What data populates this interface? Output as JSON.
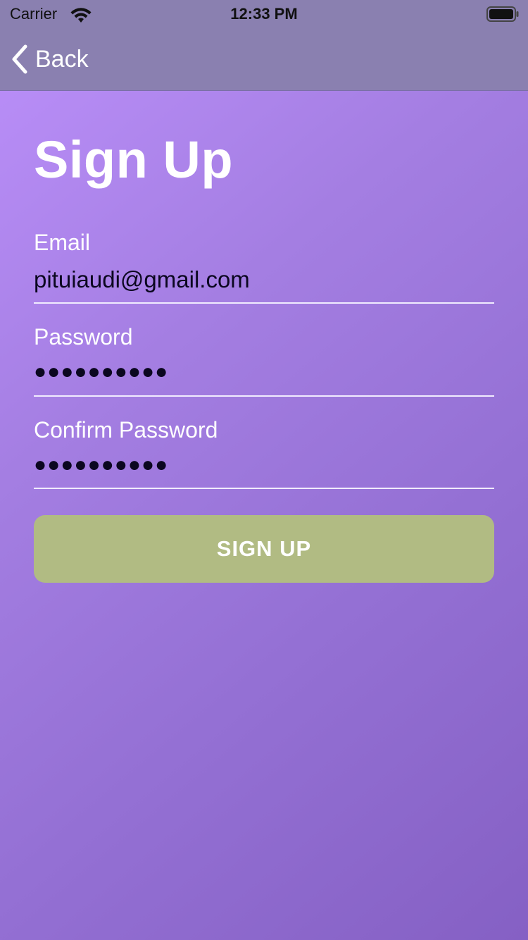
{
  "status_bar": {
    "carrier": "Carrier",
    "time": "12:33 PM"
  },
  "nav": {
    "back_label": "Back"
  },
  "page": {
    "title": "Sign Up"
  },
  "form": {
    "email": {
      "label": "Email",
      "value": "pituiaudi@gmail.com"
    },
    "password": {
      "label": "Password",
      "masked_value": "●●●●●●●●●●"
    },
    "confirm_password": {
      "label": "Confirm Password",
      "masked_value": "●●●●●●●●●●"
    },
    "submit_label": "SIGN UP"
  },
  "colors": {
    "background_gradient_start": "#bc90fb",
    "background_gradient_end": "#8560c4",
    "nav_bar": "#8a80b0",
    "button": "#b1bb83",
    "text_light": "#ffffff",
    "input_text": "#0b0720"
  },
  "icons": {
    "wifi": "wifi-icon",
    "battery": "battery-icon",
    "back": "chevron-left-icon"
  }
}
